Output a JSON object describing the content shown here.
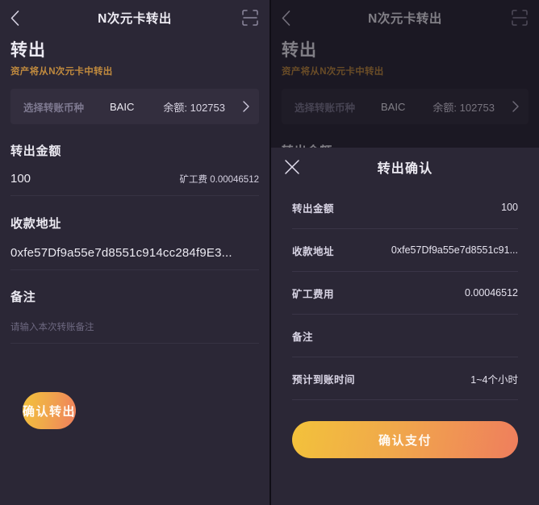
{
  "nav": {
    "back_icon": "chevron-left-icon",
    "title": "N次元卡转出",
    "scan_icon": "scan-qr-icon"
  },
  "hero": {
    "title": "转出",
    "subtitle": "资产将从N次元卡中转出"
  },
  "coin_selector": {
    "label": "选择转账币种",
    "symbol": "BAIC",
    "balance": "余额: 102753",
    "chevron_icon": "chevron-right-icon"
  },
  "form": {
    "amount": {
      "label": "转出金额",
      "value": "100",
      "fee_text": "矿工费 0.00046512"
    },
    "address": {
      "label": "收款地址",
      "value": "0xfe57Df9a55e7d8551c914cc284f9E3..."
    },
    "note": {
      "label": "备注",
      "placeholder": "请输入本次转账备注",
      "value": ""
    }
  },
  "cta": {
    "label": "确认转出"
  },
  "modal": {
    "close_icon": "close-x-icon",
    "title": "转出确认",
    "rows": [
      {
        "key": "转出金额",
        "value": "100"
      },
      {
        "key": "收款地址",
        "value": "0xfe57Df9a55e7d8551c91..."
      },
      {
        "key": "矿工费用",
        "value": "0.00046512"
      },
      {
        "key": "备注",
        "value": ""
      },
      {
        "key": "预计到账时间",
        "value": "1~4个小时"
      }
    ],
    "cta": {
      "label": "确认支付"
    }
  },
  "colors": {
    "background": "#2b2736",
    "surface": "#332e3e",
    "accent_orange": "#c08a3e",
    "gradient_start": "#f3c23b",
    "gradient_end": "#ef7e5d",
    "text_primary": "#eceaf2",
    "text_muted": "#7e7990",
    "divider": "#373243"
  }
}
